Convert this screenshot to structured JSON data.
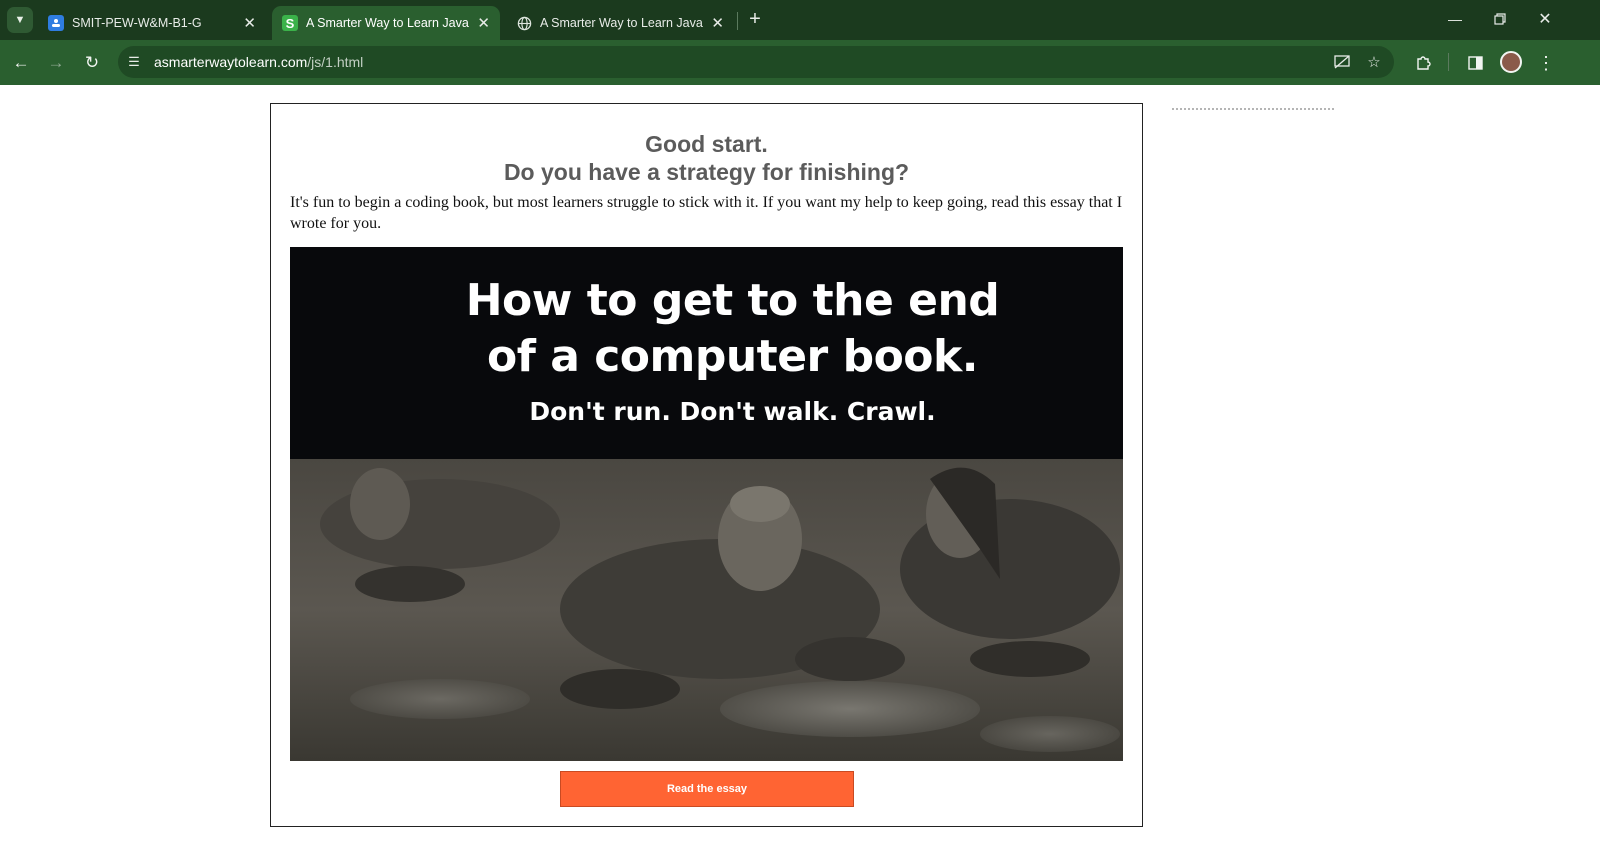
{
  "browser": {
    "tabs": [
      {
        "title": "SMIT-PEW-W&M-B1-G",
        "active": false,
        "favicon": "google-classroom-icon"
      },
      {
        "title": "A Smarter Way to Learn JavaScript",
        "active": true,
        "favicon": "smarter-way-icon"
      },
      {
        "title": "A Smarter Way to Learn JavaScript",
        "active": false,
        "favicon": "globe-icon"
      }
    ],
    "new_tab_label": "+",
    "address": {
      "domain": "asmarterwaytolearn.com",
      "path": "/js/1.html"
    },
    "colors": {
      "frame": "#1b3a1e",
      "toolbar": "#2a5f2f",
      "omnibox": "#1f4a24"
    }
  },
  "page": {
    "heading_line1": "Good start.",
    "heading_line2": "Do you have a strategy for finishing?",
    "intro": "It's fun to begin a coding book, but most learners struggle to stick with it. If you want my help to keep going, read this essay that I wrote for you.",
    "banner": {
      "title_line1": "How to get to the end",
      "title_line2": "of a computer book.",
      "subtitle": "Don't run. Don't walk. Crawl."
    },
    "cta_label": "Read the essay",
    "colors": {
      "cta": "#ff6433",
      "heading": "#5b5b5b",
      "banner_bg": "#08090c"
    }
  }
}
